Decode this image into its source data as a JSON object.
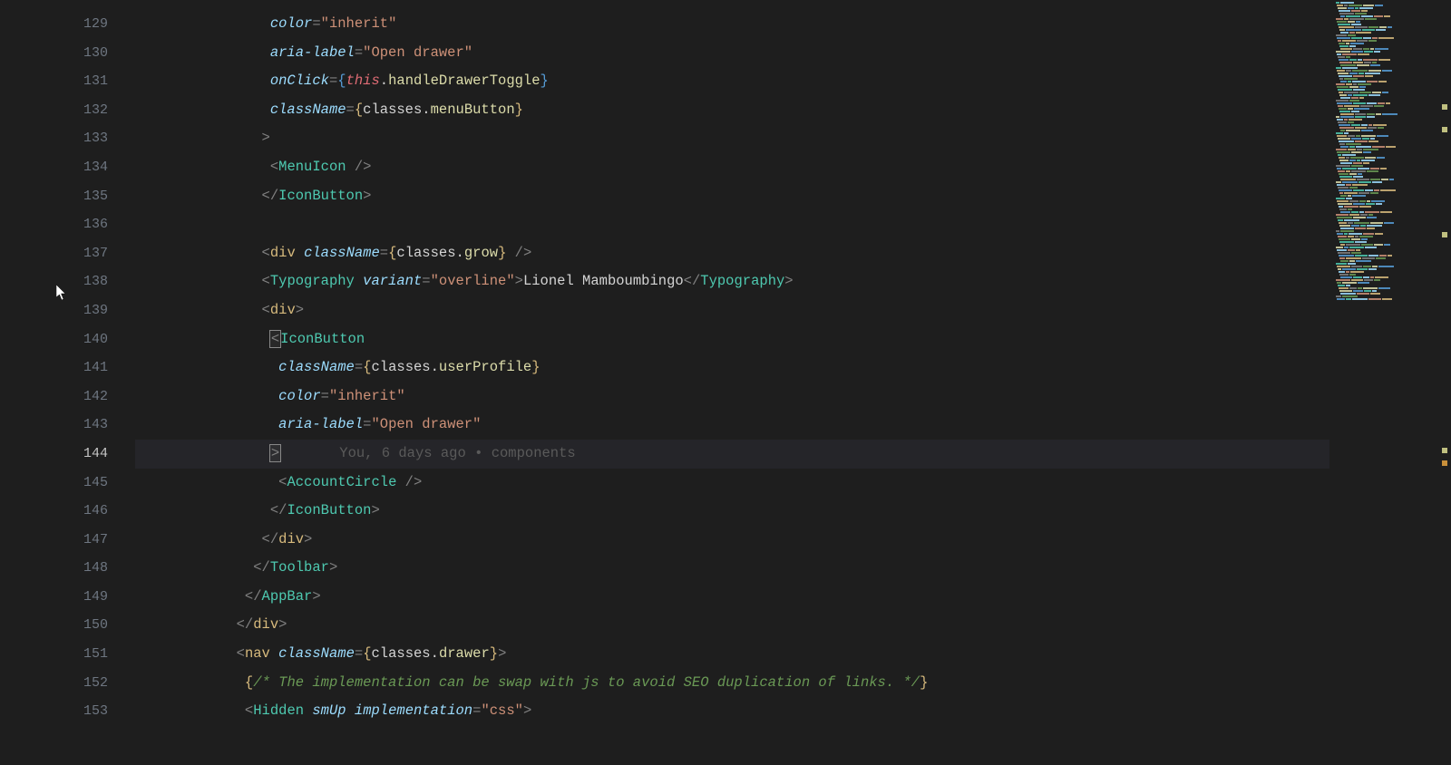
{
  "editor": {
    "activeLine": 144,
    "blame": "You, 6 days ago • components",
    "lines": [
      {
        "n": 129,
        "indent": 16,
        "tokens": [
          {
            "t": "color",
            "c": "c-attr-i"
          },
          {
            "t": "=",
            "c": "c-punct"
          },
          {
            "t": "\"inherit\"",
            "c": "c-string"
          }
        ]
      },
      {
        "n": 130,
        "indent": 16,
        "tokens": [
          {
            "t": "aria-label",
            "c": "c-attr-i"
          },
          {
            "t": "=",
            "c": "c-punct"
          },
          {
            "t": "\"Open drawer\"",
            "c": "c-string"
          }
        ]
      },
      {
        "n": 131,
        "indent": 16,
        "tokens": [
          {
            "t": "onClick",
            "c": "c-attr-i"
          },
          {
            "t": "=",
            "c": "c-punct"
          },
          {
            "t": "{",
            "c": "c-brace"
          },
          {
            "t": "this",
            "c": "c-this"
          },
          {
            "t": ".",
            "c": "c-var"
          },
          {
            "t": "handleDrawerToggle",
            "c": "c-prop"
          },
          {
            "t": "}",
            "c": "c-brace"
          }
        ]
      },
      {
        "n": 132,
        "indent": 16,
        "tokens": [
          {
            "t": "className",
            "c": "c-attr-i"
          },
          {
            "t": "=",
            "c": "c-punct"
          },
          {
            "t": "{",
            "c": "c-brace-y"
          },
          {
            "t": "classes",
            "c": "c-var"
          },
          {
            "t": ".",
            "c": "c-var"
          },
          {
            "t": "menuButton",
            "c": "c-prop"
          },
          {
            "t": "}",
            "c": "c-brace-y"
          }
        ]
      },
      {
        "n": 133,
        "indent": 15,
        "tokens": [
          {
            "t": ">",
            "c": "c-punct"
          }
        ]
      },
      {
        "n": 134,
        "indent": 16,
        "tokens": [
          {
            "t": "<",
            "c": "c-punct"
          },
          {
            "t": "MenuIcon",
            "c": "c-comp"
          },
          {
            "t": " />",
            "c": "c-punct"
          }
        ]
      },
      {
        "n": 135,
        "indent": 15,
        "tokens": [
          {
            "t": "</",
            "c": "c-punct"
          },
          {
            "t": "IconButton",
            "c": "c-comp"
          },
          {
            "t": ">",
            "c": "c-punct"
          }
        ]
      },
      {
        "n": 136,
        "indent": 0,
        "tokens": []
      },
      {
        "n": 137,
        "indent": 15,
        "tokens": [
          {
            "t": "<",
            "c": "c-punct"
          },
          {
            "t": "div",
            "c": "c-tag"
          },
          {
            "t": " ",
            "c": ""
          },
          {
            "t": "className",
            "c": "c-attr-i"
          },
          {
            "t": "=",
            "c": "c-punct"
          },
          {
            "t": "{",
            "c": "c-brace-y"
          },
          {
            "t": "classes",
            "c": "c-var"
          },
          {
            "t": ".",
            "c": "c-var"
          },
          {
            "t": "grow",
            "c": "c-prop"
          },
          {
            "t": "}",
            "c": "c-brace-y"
          },
          {
            "t": " />",
            "c": "c-punct"
          }
        ]
      },
      {
        "n": 138,
        "indent": 15,
        "tokens": [
          {
            "t": "<",
            "c": "c-punct"
          },
          {
            "t": "Typography",
            "c": "c-comp"
          },
          {
            "t": " ",
            "c": ""
          },
          {
            "t": "variant",
            "c": "c-attr-i"
          },
          {
            "t": "=",
            "c": "c-punct"
          },
          {
            "t": "\"overline\"",
            "c": "c-string"
          },
          {
            "t": ">",
            "c": "c-punct"
          },
          {
            "t": "Lionel Mamboumbingo",
            "c": "c-text"
          },
          {
            "t": "</",
            "c": "c-punct"
          },
          {
            "t": "Typography",
            "c": "c-comp"
          },
          {
            "t": ">",
            "c": "c-punct"
          }
        ]
      },
      {
        "n": 139,
        "indent": 15,
        "tokens": [
          {
            "t": "<",
            "c": "c-punct"
          },
          {
            "t": "div",
            "c": "c-tag"
          },
          {
            "t": ">",
            "c": "c-punct"
          }
        ]
      },
      {
        "n": 140,
        "indent": 16,
        "tokens": [
          {
            "t": "<",
            "c": "c-punct"
          },
          {
            "t": "IconButton",
            "c": "c-comp"
          }
        ]
      },
      {
        "n": 141,
        "indent": 17,
        "tokens": [
          {
            "t": "className",
            "c": "c-attr-i"
          },
          {
            "t": "=",
            "c": "c-punct"
          },
          {
            "t": "{",
            "c": "c-brace-y"
          },
          {
            "t": "classes",
            "c": "c-var"
          },
          {
            "t": ".",
            "c": "c-var"
          },
          {
            "t": "userProfile",
            "c": "c-prop"
          },
          {
            "t": "}",
            "c": "c-brace-y"
          }
        ]
      },
      {
        "n": 142,
        "indent": 17,
        "tokens": [
          {
            "t": "color",
            "c": "c-attr-i"
          },
          {
            "t": "=",
            "c": "c-punct"
          },
          {
            "t": "\"inherit\"",
            "c": "c-string"
          }
        ]
      },
      {
        "n": 143,
        "indent": 17,
        "tokens": [
          {
            "t": "aria-label",
            "c": "c-attr-i"
          },
          {
            "t": "=",
            "c": "c-punct"
          },
          {
            "t": "\"Open drawer\"",
            "c": "c-string"
          }
        ]
      },
      {
        "n": 144,
        "indent": 16,
        "active": true,
        "tokens": [
          {
            "t": ">",
            "c": "bracket-match"
          },
          {
            "t": "       ",
            "c": ""
          },
          {
            "t": "You, 6 days ago • components",
            "c": "c-blame"
          }
        ]
      },
      {
        "n": 145,
        "indent": 17,
        "tokens": [
          {
            "t": "<",
            "c": "c-punct"
          },
          {
            "t": "AccountCircle",
            "c": "c-comp"
          },
          {
            "t": " />",
            "c": "c-punct"
          }
        ]
      },
      {
        "n": 146,
        "indent": 16,
        "tokens": [
          {
            "t": "</",
            "c": "c-punct"
          },
          {
            "t": "IconButton",
            "c": "c-comp"
          },
          {
            "t": ">",
            "c": "c-punct"
          }
        ]
      },
      {
        "n": 147,
        "indent": 15,
        "tokens": [
          {
            "t": "</",
            "c": "c-punct"
          },
          {
            "t": "div",
            "c": "c-tag"
          },
          {
            "t": ">",
            "c": "c-punct"
          }
        ]
      },
      {
        "n": 148,
        "indent": 14,
        "tokens": [
          {
            "t": "</",
            "c": "c-punct"
          },
          {
            "t": "Toolbar",
            "c": "c-comp"
          },
          {
            "t": ">",
            "c": "c-punct"
          }
        ]
      },
      {
        "n": 149,
        "indent": 13,
        "tokens": [
          {
            "t": "</",
            "c": "c-punct"
          },
          {
            "t": "AppBar",
            "c": "c-comp"
          },
          {
            "t": ">",
            "c": "c-punct"
          }
        ]
      },
      {
        "n": 150,
        "indent": 12,
        "tokens": [
          {
            "t": "</",
            "c": "c-punct"
          },
          {
            "t": "div",
            "c": "c-tag"
          },
          {
            "t": ">",
            "c": "c-punct"
          }
        ]
      },
      {
        "n": 151,
        "indent": 12,
        "tokens": [
          {
            "t": "<",
            "c": "c-punct"
          },
          {
            "t": "nav",
            "c": "c-tag"
          },
          {
            "t": " ",
            "c": ""
          },
          {
            "t": "className",
            "c": "c-attr-i"
          },
          {
            "t": "=",
            "c": "c-punct"
          },
          {
            "t": "{",
            "c": "c-brace-y"
          },
          {
            "t": "classes",
            "c": "c-var"
          },
          {
            "t": ".",
            "c": "c-var"
          },
          {
            "t": "drawer",
            "c": "c-prop"
          },
          {
            "t": "}",
            "c": "c-brace-y"
          },
          {
            "t": ">",
            "c": "c-punct"
          }
        ]
      },
      {
        "n": 152,
        "indent": 13,
        "tokens": [
          {
            "t": "{",
            "c": "c-brace-y"
          },
          {
            "t": "/* The implementation can be swap with js to avoid SEO duplication of links. */",
            "c": "c-comment"
          },
          {
            "t": "}",
            "c": "c-brace-y"
          }
        ]
      },
      {
        "n": 153,
        "indent": 13,
        "tokens": [
          {
            "t": "<",
            "c": "c-punct"
          },
          {
            "t": "Hidden",
            "c": "c-comp"
          },
          {
            "t": " ",
            "c": ""
          },
          {
            "t": "smUp",
            "c": "c-attr-i"
          },
          {
            "t": " ",
            "c": ""
          },
          {
            "t": "implementation",
            "c": "c-attr-i"
          },
          {
            "t": "=",
            "c": "c-punct"
          },
          {
            "t": "\"css\"",
            "c": "c-string"
          },
          {
            "t": ">",
            "c": "c-punct"
          }
        ]
      }
    ]
  }
}
